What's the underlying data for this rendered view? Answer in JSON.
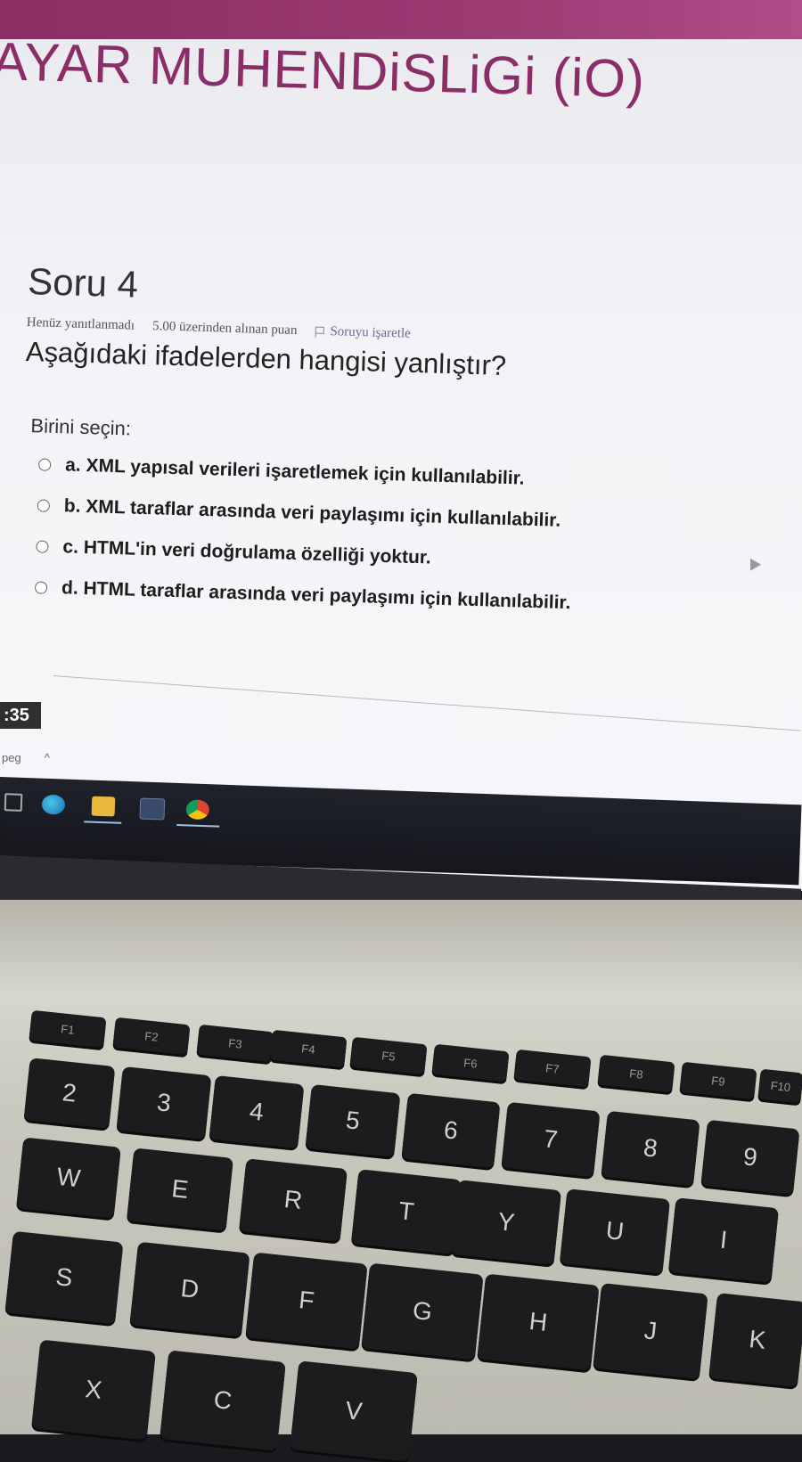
{
  "site": {
    "title": "AYAR MUHENDiSLiGi (iO)"
  },
  "question": {
    "heading": "Soru 4",
    "status": "Henüz yanıtlanmadı",
    "points": "5.00 üzerinden alınan puan",
    "flag_label": "Soruyu işaretle",
    "text": "Aşağıdaki ifadelerden hangisi yanlıştır?",
    "choose_label": "Birini seçin:",
    "options": [
      {
        "label": "a. XML yapısal verileri işaretlemek için kullanılabilir."
      },
      {
        "label": "b. XML taraflar arasında veri paylaşımı için kullanılabilir."
      },
      {
        "label": "c. HTML'in veri doğrulama özelliği yoktur."
      },
      {
        "label": "d. HTML taraflar arasında veri paylaşımı için kullanılabilir."
      }
    ]
  },
  "overlay": {
    "timer_fragment": ":35",
    "download_fragment": "peg",
    "chevron": "^"
  },
  "taskbar": {
    "icons": [
      "start-icon",
      "edge-icon",
      "file-explorer-icon",
      "mail-icon",
      "chrome-icon"
    ]
  },
  "keyboard": {
    "function_row": [
      "F1",
      "F2",
      "F3",
      "F4",
      "F5",
      "F6",
      "F7",
      "F8",
      "F9",
      "F10"
    ],
    "number_row": [
      "2",
      "3",
      "4",
      "5",
      "6",
      "7",
      "8",
      "9"
    ],
    "top_row": [
      "W",
      "E",
      "R",
      "T",
      "Y",
      "U",
      "I"
    ],
    "home_row": [
      "S",
      "D",
      "F",
      "G",
      "H",
      "J",
      "K"
    ],
    "bottom_row": [
      "X",
      "C",
      "V"
    ]
  },
  "colors": {
    "brand": "#8b2d67",
    "band": "#9c3a72",
    "page_bg": "#f4f4f8",
    "key": "#1c1c1e"
  }
}
